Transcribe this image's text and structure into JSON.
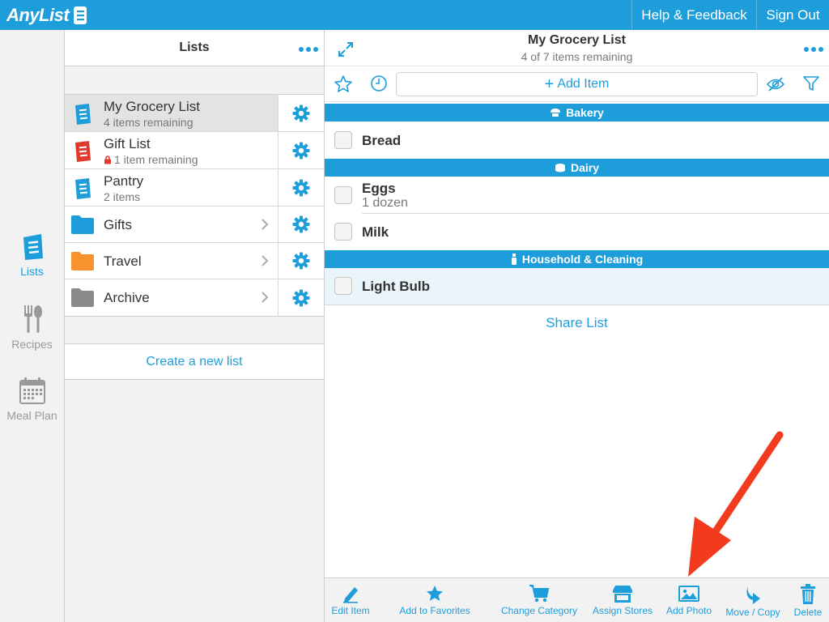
{
  "app": {
    "logo_text": "AnyList"
  },
  "header": {
    "help_label": "Help & Feedback",
    "signout_label": "Sign Out"
  },
  "nav": {
    "lists": "Lists",
    "recipes": "Recipes",
    "meal_plan": "Meal Plan"
  },
  "lists_panel": {
    "title": "Lists",
    "rows": [
      {
        "title": "My Grocery List",
        "subtitle": "4 items remaining"
      },
      {
        "title": "Gift List",
        "subtitle": "1 item remaining"
      },
      {
        "title": "Pantry",
        "subtitle": "2 items"
      },
      {
        "title": "Gifts"
      },
      {
        "title": "Travel"
      },
      {
        "title": "Archive"
      }
    ],
    "create_label": "Create a new list"
  },
  "main": {
    "title": "My Grocery List",
    "subtitle": "4 of 7 items remaining",
    "add_item_label": "Add Item",
    "categories": [
      {
        "name": "Bakery",
        "items": [
          {
            "name": "Bread"
          }
        ]
      },
      {
        "name": "Dairy",
        "items": [
          {
            "name": "Eggs",
            "note": "1 dozen"
          },
          {
            "name": "Milk"
          }
        ]
      },
      {
        "name": "Household & Cleaning",
        "items": [
          {
            "name": "Light Bulb"
          }
        ]
      }
    ],
    "share_label": "Share List"
  },
  "bottom_bar": {
    "edit_item": "Edit Item",
    "add_favorites": "Add to Favorites",
    "change_category": "Change Category",
    "assign_stores": "Assign Stores",
    "add_photo": "Add Photo",
    "move_copy": "Move / Copy",
    "delete": "Delete"
  },
  "colors": {
    "accent": "#1e9ddb",
    "gift_list": "#e0392b",
    "travel_folder": "#f7922f",
    "archive_folder": "#8a8a8a",
    "annotation_arrow": "#f23a1f"
  }
}
